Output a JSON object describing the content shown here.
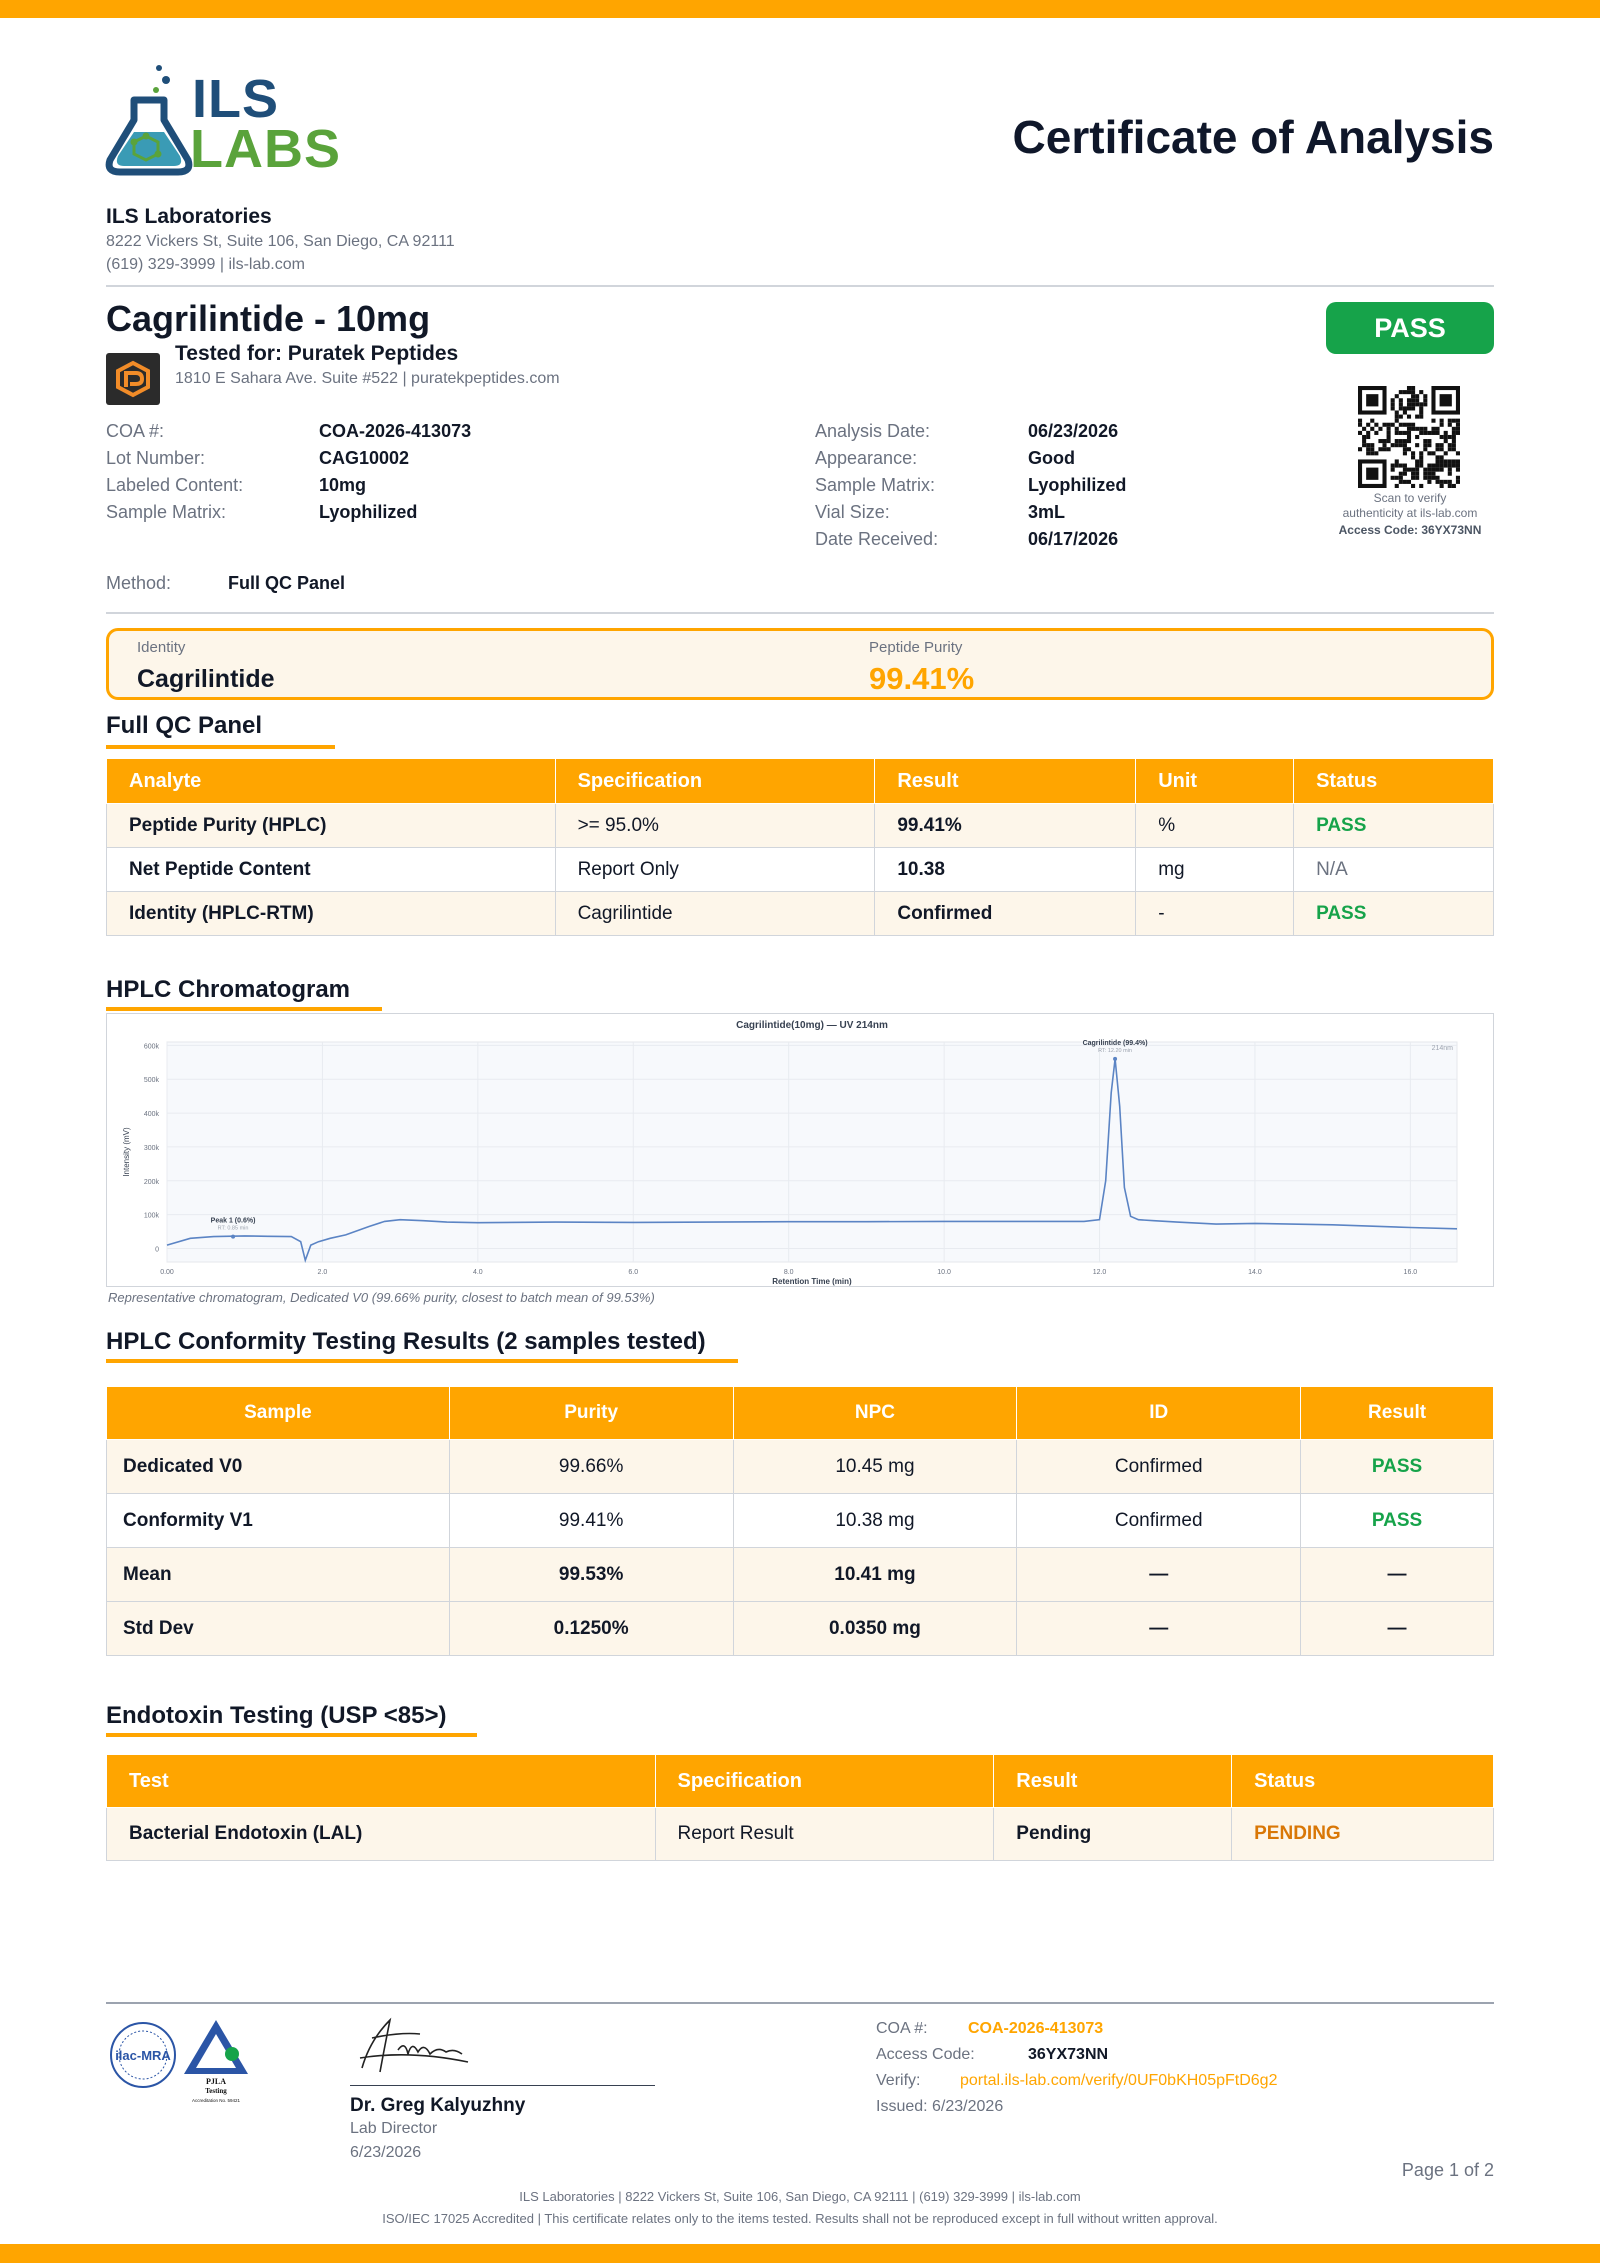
{
  "header": {
    "logo_top": "ILS",
    "logo_bottom": "LABS",
    "title": "Certificate of Analysis",
    "lab_name": "ILS Laboratories",
    "lab_address": "8222 Vickers St, Suite 106, San Diego, CA 92111",
    "lab_contact": "(619) 329-3999  |  ils-lab.com"
  },
  "product": {
    "title": "Cagrilintide - 10mg",
    "status": "PASS",
    "tested_for": "Tested for: Puratek Peptides",
    "client_address": "1810 E Sahara Ave. Suite #522  |  puratekpeptides.com"
  },
  "fields_left": [
    {
      "label": "COA #:",
      "value": "COA-2026-413073"
    },
    {
      "label": "Lot Number:",
      "value": "CAG10002"
    },
    {
      "label": "Labeled Content:",
      "value": "10mg"
    },
    {
      "label": "Sample Matrix:",
      "value": "Lyophilized"
    }
  ],
  "fields_right": [
    {
      "label": "Analysis Date:",
      "value": "06/23/2026"
    },
    {
      "label": "Appearance:",
      "value": "Good"
    },
    {
      "label": "Sample Matrix:",
      "value": "Lyophilized"
    },
    {
      "label": "Vial Size:",
      "value": "3mL"
    },
    {
      "label": "Date Received:",
      "value": "06/17/2026"
    }
  ],
  "method": {
    "label": "Method:",
    "value": "Full QC Panel"
  },
  "qr": {
    "caption1": "Scan to verify",
    "caption2": "authenticity at ils-lab.com",
    "access_code": "Access Code: 36YX73NN"
  },
  "summary": {
    "identity_label": "Identity",
    "identity_value": "Cagrilintide",
    "purity_label": "Peptide Purity",
    "purity_value": "99.41%"
  },
  "qc_panel": {
    "title": "Full QC Panel",
    "headers": [
      "Analyte",
      "Specification",
      "Result",
      "Unit",
      "Status"
    ],
    "rows": [
      [
        "Peptide Purity (HPLC)",
        ">= 95.0%",
        "99.41%",
        "%",
        "PASS"
      ],
      [
        "Net Peptide Content",
        "Report Only",
        "10.38",
        "mg",
        "N/A"
      ],
      [
        "Identity (HPLC-RTM)",
        "Cagrilintide",
        "Confirmed",
        "-",
        "PASS"
      ]
    ]
  },
  "chromatogram": {
    "section_title": "HPLC Chromatogram",
    "caption": "Representative chromatogram, Dedicated V0 (99.66% purity, closest to batch mean of 99.53%)"
  },
  "chart_data": {
    "type": "line",
    "title": "Cagrilintide(10mg) — UV 214nm",
    "xlabel": "Retention Time (min)",
    "ylabel": "Intensity (mV)",
    "corner_label": "214nm",
    "xlim": [
      0,
      16.6
    ],
    "ylim": [
      -40000,
      610000
    ],
    "x_ticks": [
      "0.00",
      "2.0",
      "4.0",
      "6.0",
      "8.0",
      "10.0",
      "12.0",
      "14.0",
      "16.0"
    ],
    "x_tick_values": [
      0,
      2,
      4,
      6,
      8,
      10,
      12,
      14,
      16
    ],
    "y_ticks": [
      "0",
      "100k",
      "200k",
      "300k",
      "400k",
      "500k",
      "600k"
    ],
    "y_tick_values": [
      0,
      100000,
      200000,
      300000,
      400000,
      500000,
      600000
    ],
    "series": [
      {
        "x": [
          0,
          0.3,
          0.6,
          1.0,
          1.3,
          1.6,
          1.72,
          1.78,
          1.85,
          1.95,
          2.1,
          2.3,
          2.6,
          2.8,
          3.0,
          3.3,
          3.6,
          4.0,
          5.0,
          6.0,
          7.0,
          8.0,
          9.0,
          10.0,
          11.0,
          11.8,
          12.0,
          12.08,
          12.15,
          12.2,
          12.26,
          12.32,
          12.4,
          12.5,
          12.7,
          13.0,
          13.5,
          14.0,
          15.0,
          16.0,
          16.6
        ],
        "y": [
          10000,
          30000,
          35000,
          37000,
          36000,
          35000,
          20000,
          -35000,
          10000,
          20000,
          30000,
          40000,
          65000,
          80000,
          85000,
          82000,
          78000,
          76000,
          78000,
          77000,
          78000,
          79000,
          79000,
          80000,
          80000,
          80000,
          85000,
          200000,
          460000,
          560000,
          420000,
          180000,
          95000,
          85000,
          82000,
          78000,
          72000,
          74000,
          70000,
          62000,
          58000
        ]
      }
    ],
    "annotations": [
      {
        "label": "Peak 1 (0.6%)",
        "sub": "RT: 0.85 min",
        "x": 0.85,
        "y": 35000
      },
      {
        "label": "Cagrilintide (99.4%)",
        "sub": "RT: 12.20 min",
        "x": 12.2,
        "y": 560000
      }
    ]
  },
  "conformity": {
    "title": "HPLC Conformity Testing Results (2 samples tested)",
    "headers": [
      "Sample",
      "Purity",
      "NPC",
      "ID",
      "Result"
    ],
    "rows": [
      [
        "Dedicated V0",
        "99.66%",
        "10.45 mg",
        "Confirmed",
        "PASS"
      ],
      [
        "Conformity V1",
        "99.41%",
        "10.38 mg",
        "Confirmed",
        "PASS"
      ],
      [
        "Mean",
        "99.53%",
        "10.41 mg",
        "—",
        "—"
      ],
      [
        "Std Dev",
        "0.1250%",
        "0.0350 mg",
        "—",
        "—"
      ]
    ]
  },
  "endotoxin": {
    "title": "Endotoxin Testing (USP <85>)",
    "headers": [
      "Test",
      "Specification",
      "Result",
      "Status"
    ],
    "rows": [
      [
        "Bacterial Endotoxin (LAL)",
        "Report Result",
        "Pending",
        "PENDING"
      ]
    ]
  },
  "signature": {
    "seal_ilac": "ilac-MRA",
    "seal_pjla": "PJLA",
    "seal_pjla_sub": "Testing",
    "seal_accred": "Accreditation No. 59421",
    "signer_name": "Dr. Greg Kalyuzhny",
    "signer_title": "Lab Director",
    "signer_date": "6/23/2026"
  },
  "footer_info": {
    "coa_label": "COA #:",
    "coa_value": "COA-2026-413073",
    "access_label": "Access Code:",
    "access_value": "36YX73NN",
    "verify_label": "Verify:",
    "verify_value": "portal.ils-lab.com/verify/0UF0bKH05pFtD6g2",
    "issued": "Issued: 6/23/2026"
  },
  "page_number": "Page 1 of 2",
  "footer": {
    "line1": "ILS Laboratories  |  8222 Vickers St, Suite 106, San Diego, CA 92111  |  (619) 329-3999  |  ils-lab.com",
    "line2": "ISO/IEC 17025 Accredited  |  This certificate relates only to the items tested. Results shall not be reproduced except in full without written approval."
  },
  "colors": {
    "accent": "#FFA500",
    "pass": "#16a34a",
    "pending": "#d97706",
    "logo_blue": "#1f4e79",
    "logo_green": "#5aa33b"
  }
}
